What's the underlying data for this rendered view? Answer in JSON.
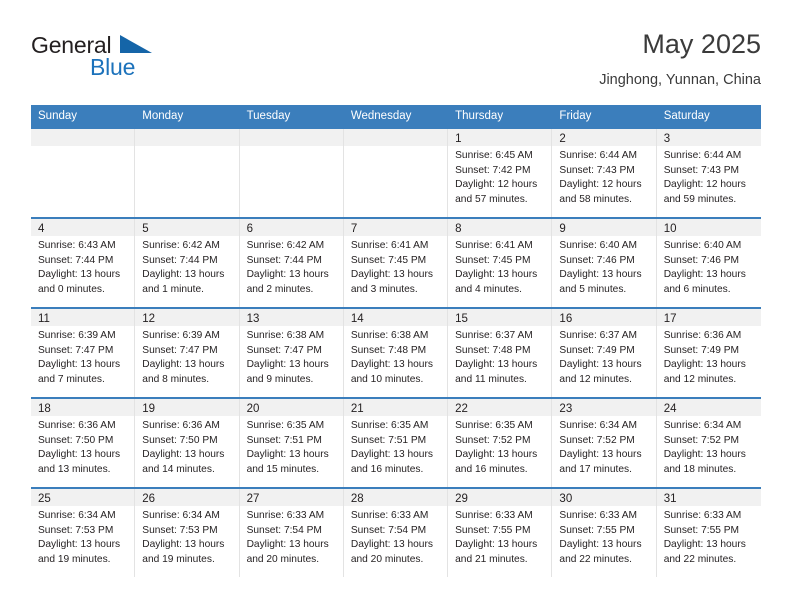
{
  "brand": {
    "line1": "General",
    "line2": "Blue",
    "triangle_icon": "blue-triangle-icon",
    "accent_color": "#1c72bb"
  },
  "header": {
    "title": "May 2025",
    "subtitle": "Jinghong, Yunnan, China"
  },
  "theme": {
    "header_bar_color": "#3b7ebc",
    "day_strip_color": "#f1f1f1",
    "text_color": "#231f20"
  },
  "weekdays": [
    "Sunday",
    "Monday",
    "Tuesday",
    "Wednesday",
    "Thursday",
    "Friday",
    "Saturday"
  ],
  "labels": {
    "sunrise": "Sunrise:",
    "sunset": "Sunset:",
    "daylight": "Daylight:"
  },
  "weeks": [
    [
      {
        "empty": true
      },
      {
        "empty": true
      },
      {
        "empty": true
      },
      {
        "empty": true
      },
      {
        "day": "1",
        "sunrise": "Sunrise: 6:45 AM",
        "sunset": "Sunset: 7:42 PM",
        "daylight": "Daylight: 12 hours and 57 minutes."
      },
      {
        "day": "2",
        "sunrise": "Sunrise: 6:44 AM",
        "sunset": "Sunset: 7:43 PM",
        "daylight": "Daylight: 12 hours and 58 minutes."
      },
      {
        "day": "3",
        "sunrise": "Sunrise: 6:44 AM",
        "sunset": "Sunset: 7:43 PM",
        "daylight": "Daylight: 12 hours and 59 minutes."
      }
    ],
    [
      {
        "day": "4",
        "sunrise": "Sunrise: 6:43 AM",
        "sunset": "Sunset: 7:44 PM",
        "daylight": "Daylight: 13 hours and 0 minutes."
      },
      {
        "day": "5",
        "sunrise": "Sunrise: 6:42 AM",
        "sunset": "Sunset: 7:44 PM",
        "daylight": "Daylight: 13 hours and 1 minute."
      },
      {
        "day": "6",
        "sunrise": "Sunrise: 6:42 AM",
        "sunset": "Sunset: 7:44 PM",
        "daylight": "Daylight: 13 hours and 2 minutes."
      },
      {
        "day": "7",
        "sunrise": "Sunrise: 6:41 AM",
        "sunset": "Sunset: 7:45 PM",
        "daylight": "Daylight: 13 hours and 3 minutes."
      },
      {
        "day": "8",
        "sunrise": "Sunrise: 6:41 AM",
        "sunset": "Sunset: 7:45 PM",
        "daylight": "Daylight: 13 hours and 4 minutes."
      },
      {
        "day": "9",
        "sunrise": "Sunrise: 6:40 AM",
        "sunset": "Sunset: 7:46 PM",
        "daylight": "Daylight: 13 hours and 5 minutes."
      },
      {
        "day": "10",
        "sunrise": "Sunrise: 6:40 AM",
        "sunset": "Sunset: 7:46 PM",
        "daylight": "Daylight: 13 hours and 6 minutes."
      }
    ],
    [
      {
        "day": "11",
        "sunrise": "Sunrise: 6:39 AM",
        "sunset": "Sunset: 7:47 PM",
        "daylight": "Daylight: 13 hours and 7 minutes."
      },
      {
        "day": "12",
        "sunrise": "Sunrise: 6:39 AM",
        "sunset": "Sunset: 7:47 PM",
        "daylight": "Daylight: 13 hours and 8 minutes."
      },
      {
        "day": "13",
        "sunrise": "Sunrise: 6:38 AM",
        "sunset": "Sunset: 7:47 PM",
        "daylight": "Daylight: 13 hours and 9 minutes."
      },
      {
        "day": "14",
        "sunrise": "Sunrise: 6:38 AM",
        "sunset": "Sunset: 7:48 PM",
        "daylight": "Daylight: 13 hours and 10 minutes."
      },
      {
        "day": "15",
        "sunrise": "Sunrise: 6:37 AM",
        "sunset": "Sunset: 7:48 PM",
        "daylight": "Daylight: 13 hours and 11 minutes."
      },
      {
        "day": "16",
        "sunrise": "Sunrise: 6:37 AM",
        "sunset": "Sunset: 7:49 PM",
        "daylight": "Daylight: 13 hours and 12 minutes."
      },
      {
        "day": "17",
        "sunrise": "Sunrise: 6:36 AM",
        "sunset": "Sunset: 7:49 PM",
        "daylight": "Daylight: 13 hours and 12 minutes."
      }
    ],
    [
      {
        "day": "18",
        "sunrise": "Sunrise: 6:36 AM",
        "sunset": "Sunset: 7:50 PM",
        "daylight": "Daylight: 13 hours and 13 minutes."
      },
      {
        "day": "19",
        "sunrise": "Sunrise: 6:36 AM",
        "sunset": "Sunset: 7:50 PM",
        "daylight": "Daylight: 13 hours and 14 minutes."
      },
      {
        "day": "20",
        "sunrise": "Sunrise: 6:35 AM",
        "sunset": "Sunset: 7:51 PM",
        "daylight": "Daylight: 13 hours and 15 minutes."
      },
      {
        "day": "21",
        "sunrise": "Sunrise: 6:35 AM",
        "sunset": "Sunset: 7:51 PM",
        "daylight": "Daylight: 13 hours and 16 minutes."
      },
      {
        "day": "22",
        "sunrise": "Sunrise: 6:35 AM",
        "sunset": "Sunset: 7:52 PM",
        "daylight": "Daylight: 13 hours and 16 minutes."
      },
      {
        "day": "23",
        "sunrise": "Sunrise: 6:34 AM",
        "sunset": "Sunset: 7:52 PM",
        "daylight": "Daylight: 13 hours and 17 minutes."
      },
      {
        "day": "24",
        "sunrise": "Sunrise: 6:34 AM",
        "sunset": "Sunset: 7:52 PM",
        "daylight": "Daylight: 13 hours and 18 minutes."
      }
    ],
    [
      {
        "day": "25",
        "sunrise": "Sunrise: 6:34 AM",
        "sunset": "Sunset: 7:53 PM",
        "daylight": "Daylight: 13 hours and 19 minutes."
      },
      {
        "day": "26",
        "sunrise": "Sunrise: 6:34 AM",
        "sunset": "Sunset: 7:53 PM",
        "daylight": "Daylight: 13 hours and 19 minutes."
      },
      {
        "day": "27",
        "sunrise": "Sunrise: 6:33 AM",
        "sunset": "Sunset: 7:54 PM",
        "daylight": "Daylight: 13 hours and 20 minutes."
      },
      {
        "day": "28",
        "sunrise": "Sunrise: 6:33 AM",
        "sunset": "Sunset: 7:54 PM",
        "daylight": "Daylight: 13 hours and 20 minutes."
      },
      {
        "day": "29",
        "sunrise": "Sunrise: 6:33 AM",
        "sunset": "Sunset: 7:55 PM",
        "daylight": "Daylight: 13 hours and 21 minutes."
      },
      {
        "day": "30",
        "sunrise": "Sunrise: 6:33 AM",
        "sunset": "Sunset: 7:55 PM",
        "daylight": "Daylight: 13 hours and 22 minutes."
      },
      {
        "day": "31",
        "sunrise": "Sunrise: 6:33 AM",
        "sunset": "Sunset: 7:55 PM",
        "daylight": "Daylight: 13 hours and 22 minutes."
      }
    ]
  ]
}
